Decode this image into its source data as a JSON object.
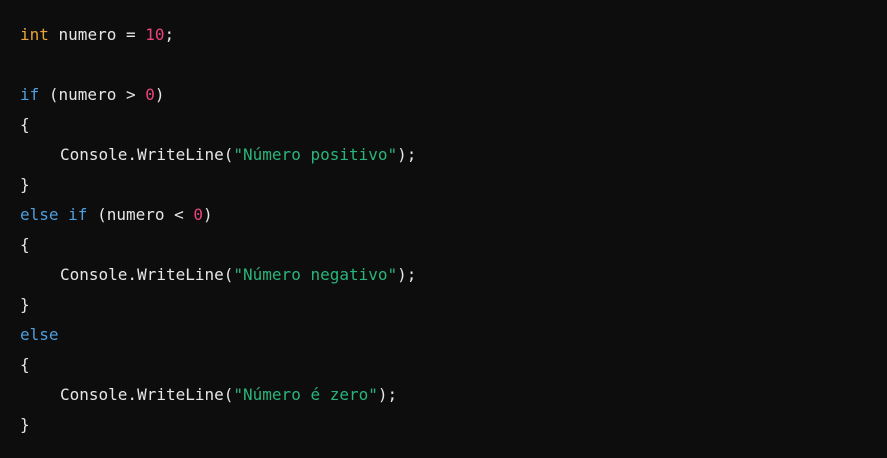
{
  "code": {
    "line1": {
      "type": "int",
      "var": " numero = ",
      "num": "10",
      "end": ";"
    },
    "line3": {
      "kw": "if",
      "mid": " (numero > ",
      "num": "0",
      "end": ")"
    },
    "open_brace": "{",
    "close_brace": "}",
    "console_call": "Console.WriteLine(",
    "call_end": ");",
    "str_positive": "\"Número positivo\"",
    "line7": {
      "kw": "else if",
      "mid": " (numero < ",
      "num": "0",
      "end": ")"
    },
    "str_negative": "\"Número negativo\"",
    "else_kw": "else",
    "str_zero": "\"Número é zero\""
  },
  "colors": {
    "background": "#0d0d0d",
    "type_keyword": "#e8a33a",
    "keyword": "#4f9ede",
    "number": "#e8457a",
    "string": "#29b47c",
    "text": "#e6e6e6"
  }
}
